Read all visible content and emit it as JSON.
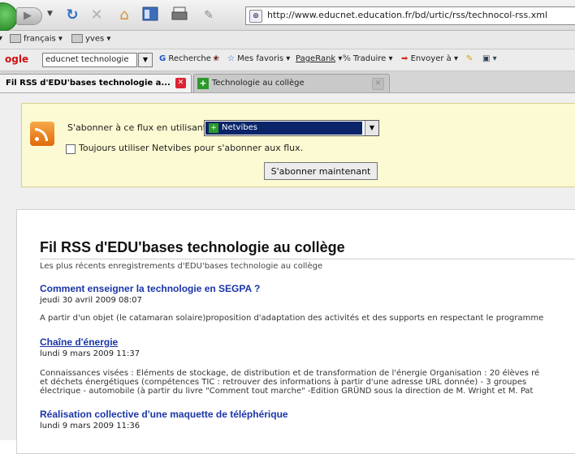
{
  "browser": {
    "url": "http://www.educnet.education.fr/bd/urtic/rss/technocol-rss.xml",
    "lang_items": [
      "français",
      "yves"
    ]
  },
  "google_bar": {
    "logo": "ogle",
    "search_value": "educnet technologie",
    "buttons": [
      "Recherche",
      "Mes favoris",
      "PageRank",
      "Traduire",
      "Envoyer à"
    ]
  },
  "tabs": [
    {
      "label": "Fil RSS d'EDU'bases technologie a...",
      "active": true
    },
    {
      "label": "Technologie au collège",
      "active": false
    }
  ],
  "subscribe": {
    "label": "S'abonner à ce flux en utilisant",
    "reader": "Netvibes",
    "always_label": "Toujours utiliser Netvibes pour s'abonner aux flux.",
    "always_checked": false,
    "button": "S'abonner maintenant"
  },
  "feed": {
    "title": "Fil RSS d'EDU'bases technologie au collège",
    "subtitle": "Les plus récents enregistrements d'EDU'bases technologie au collège",
    "entries": [
      {
        "title": "Comment enseigner la technologie en SEGPA ?",
        "date": "jeudi 30 avril 2009 08:07",
        "text": [
          "A partir d'un objet (le catamaran solaire)proposition d'adaptation des activités et des supports en respectant le programme"
        ]
      },
      {
        "title": "Chaîne d'énergie",
        "date": "lundi 9 mars 2009 11:37",
        "text": [
          "Connaissances visées : Eléments de stockage, de distribution et de transformation de l'énergie Organisation : 20 élèves ré",
          "et déchets énergétiques (compétences TIC : retrouver des informations à partir d'une adresse URL donnée) - 3 groupes",
          "électrique - automobile (à partir du livre \"Comment tout marche\" -Edition GRÜND sous la direction de M. Wright et M. Pat"
        ]
      },
      {
        "title": "Réalisation collective d'une maquette de téléphérique",
        "date": "lundi 9 mars 2009 11:36",
        "text": []
      }
    ]
  }
}
